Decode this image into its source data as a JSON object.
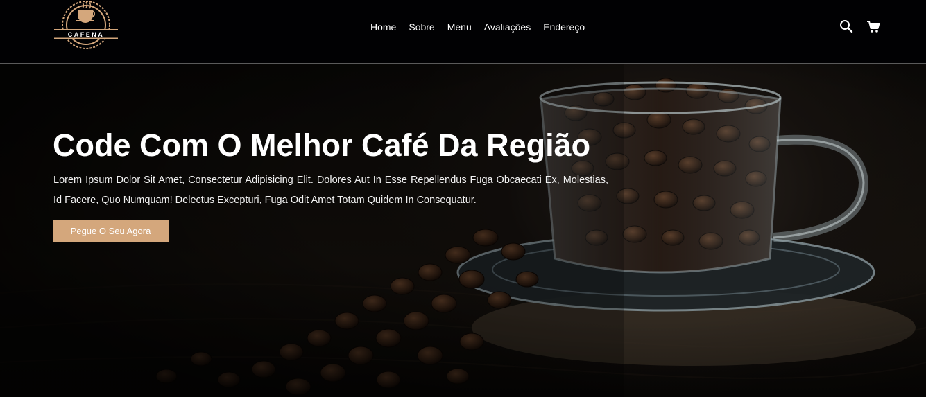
{
  "brand": {
    "logo_text": "CAFENA"
  },
  "nav": {
    "items": [
      {
        "label": "Home"
      },
      {
        "label": "Sobre"
      },
      {
        "label": "Menu"
      },
      {
        "label": "Avaliações"
      },
      {
        "label": "Endereço"
      }
    ]
  },
  "header_icons": [
    "search-icon",
    "cart-icon"
  ],
  "hero": {
    "title": "Code Com O Melhor Café Da Região",
    "text": "Lorem Ipsum Dolor Sit Amet, Consectetur Adipisicing Elit. Dolores Aut In Esse Repellendus Fuga Obcaecati Ex, Molestias, Id Facere, Quo Numquam! Delectus Excepturi, Fuga Odit Amet Totam Quidem In Consequatur.",
    "cta_label": "Pegue O Seu Agora"
  },
  "colors": {
    "accent": "#d4a77c",
    "header_bg": "#010103",
    "text": "#ffffff"
  }
}
